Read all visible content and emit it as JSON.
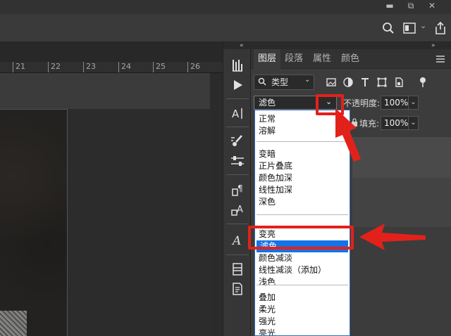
{
  "window": {
    "minimize_glyph": "▬",
    "restore_glyph": "⧉",
    "close_glyph": "✕"
  },
  "options_bar": {
    "icons": [
      "search-icon",
      "workspace-icon",
      "share-icon"
    ]
  },
  "ruler": {
    "ticks": [
      "21",
      "22",
      "23",
      "24",
      "25",
      "26"
    ]
  },
  "dock": {
    "collapse_glyph": "«",
    "tools": [
      "histogram-icon",
      "play-icon",
      "character-icon",
      "brush-settings-icon",
      "adjust-sliders-icon",
      "paragraph-style-icon",
      "character-style-icon",
      "glyphs-icon",
      "layer-comps-icon",
      "notes-icon"
    ]
  },
  "panel": {
    "collapse_glyph": "»",
    "tabs": [
      "图层",
      "段落",
      "属性",
      "颜色"
    ],
    "active_tab": "图层",
    "filter": {
      "kind_label": "类型"
    },
    "blend_mode": {
      "value": "滤色"
    },
    "opacity": {
      "label": "不透明度:",
      "value": "100%"
    },
    "fill": {
      "label": "填充:",
      "value": "100%"
    }
  },
  "blend_menu": {
    "groups": [
      [
        "正常",
        "溶解"
      ],
      [
        "变暗",
        "正片叠底",
        "颜色加深",
        "线性加深",
        "深色"
      ],
      [
        "变亮",
        "滤色",
        "颜色减淡",
        "线性减淡（添加）",
        "浅色"
      ],
      [
        "叠加",
        "柔光",
        "强光",
        "亮光"
      ]
    ],
    "selected": "滤色"
  },
  "colors": {
    "accent_selection": "#1473e6",
    "annotation_red": "#e3211b",
    "ui_dark": "#3c3c3c"
  }
}
